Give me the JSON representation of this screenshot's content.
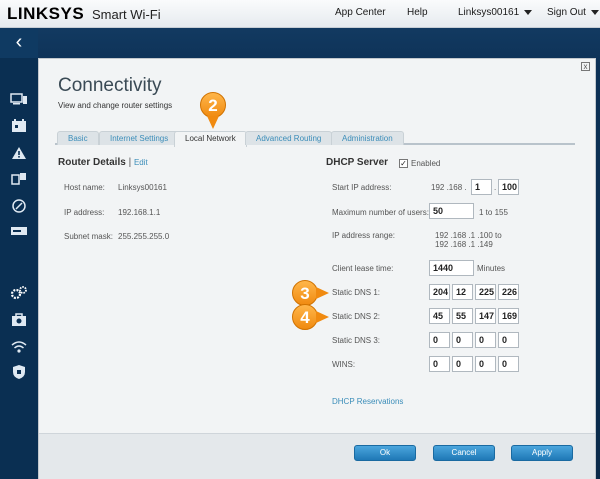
{
  "brand": {
    "logo": "LINKSYS",
    "product": "Smart Wi-Fi"
  },
  "topnav": {
    "app_center": "App Center",
    "help": "Help",
    "user": "Linksys00161",
    "sign_out": "Sign Out"
  },
  "page": {
    "title": "Connectivity",
    "subtitle": "View and change router settings"
  },
  "tabs": [
    {
      "label": "Basic"
    },
    {
      "label": "Internet Settings"
    },
    {
      "label": "Local Network"
    },
    {
      "label": "Advanced Routing"
    },
    {
      "label": "Administration"
    }
  ],
  "router_details": {
    "heading": "Router Details",
    "edit": "Edit",
    "host_label": "Host name:",
    "host_value": "Linksys00161",
    "ip_label": "IP address:",
    "ip_value": "192.168.1.1",
    "mask_label": "Subnet mask:",
    "mask_value": "255.255.255.0"
  },
  "dhcp": {
    "heading": "DHCP Server",
    "enabled_label": "Enabled",
    "enabled_mark": "✓",
    "start_ip_label": "Start IP address:",
    "start_ip_prefix": "192 .168 .",
    "start_ip_3": "1",
    "start_ip_4": "100",
    "max_users_label": "Maximum number of users:",
    "max_users": "50",
    "max_users_range": "1 to 155",
    "range_label": "IP address range:",
    "range_line1": "192 .168 .1 .100  to",
    "range_line2": "192 .168 .1 .149",
    "lease_label": "Client lease time:",
    "lease_value": "1440",
    "lease_unit": "Minutes",
    "dns1_label": "Static DNS 1:",
    "dns1": [
      "204",
      "12",
      "225",
      "226"
    ],
    "dns2_label": "Static DNS 2:",
    "dns2": [
      "45",
      "55",
      "147",
      "169"
    ],
    "dns3_label": "Static DNS 3:",
    "dns3": [
      "0",
      "0",
      "0",
      "0"
    ],
    "wins_label": "WINS:",
    "wins": [
      "0",
      "0",
      "0",
      "0"
    ],
    "reservations": "DHCP Reservations"
  },
  "callouts": {
    "c2": "2",
    "c3": "3",
    "c4": "4"
  },
  "buttons": {
    "ok": "Ok",
    "cancel": "Cancel",
    "apply": "Apply"
  },
  "icons": {
    "back": "‹",
    "close": "x"
  }
}
